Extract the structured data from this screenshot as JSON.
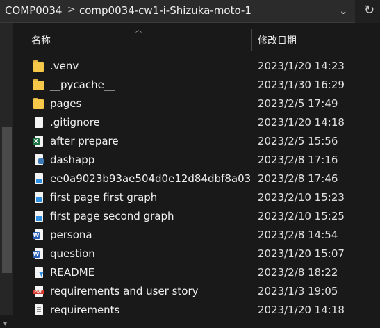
{
  "address_bar": {
    "path": [
      "COMP0034",
      "comp0034-cw1-i-Shizuka-moto-1"
    ],
    "separator": ">",
    "dropdown_icon": "chevron-down-icon",
    "refresh_icon": "refresh-icon"
  },
  "columns": {
    "name": "名称",
    "date_modified": "修改日期"
  },
  "files": [
    {
      "name": ".venv",
      "date": "2023/1/20 14:23",
      "icon": "folder-icon"
    },
    {
      "name": "__pycache__",
      "date": "2023/1/30 16:29",
      "icon": "folder-icon"
    },
    {
      "name": "pages",
      "date": "2023/2/5 17:49",
      "icon": "folder-icon"
    },
    {
      "name": ".gitignore",
      "date": "2023/1/20 14:18",
      "icon": "text-file-icon"
    },
    {
      "name": "after prepare",
      "date": "2023/2/5 15:56",
      "icon": "excel-file-icon"
    },
    {
      "name": "dashapp",
      "date": "2023/2/8 17:16",
      "icon": "python-file-icon"
    },
    {
      "name": "ee0a9023b93ae504d0e12d84dbf8a03",
      "date": "2023/2/8 17:46",
      "icon": "image-file-icon"
    },
    {
      "name": "first page first graph",
      "date": "2023/2/10 15:23",
      "icon": "image-file-icon"
    },
    {
      "name": "first page second graph",
      "date": "2023/2/10 15:25",
      "icon": "image-file-icon"
    },
    {
      "name": "persona",
      "date": "2023/2/8 14:54",
      "icon": "word-file-icon"
    },
    {
      "name": "question",
      "date": "2023/1/20 15:07",
      "icon": "word-file-icon"
    },
    {
      "name": "README",
      "date": "2023/2/8 18:22",
      "icon": "markdown-file-icon"
    },
    {
      "name": "requirements and user story",
      "date": "2023/1/3 19:05",
      "icon": "pdf-file-icon"
    },
    {
      "name": "requirements",
      "date": "2023/1/20 14:18",
      "icon": "text-file-icon"
    }
  ],
  "colors": {
    "background": "#191919",
    "folder": "#f5c84a",
    "excel": "#1f7244",
    "word": "#2b5fb4",
    "pdf": "#d83a2f"
  }
}
